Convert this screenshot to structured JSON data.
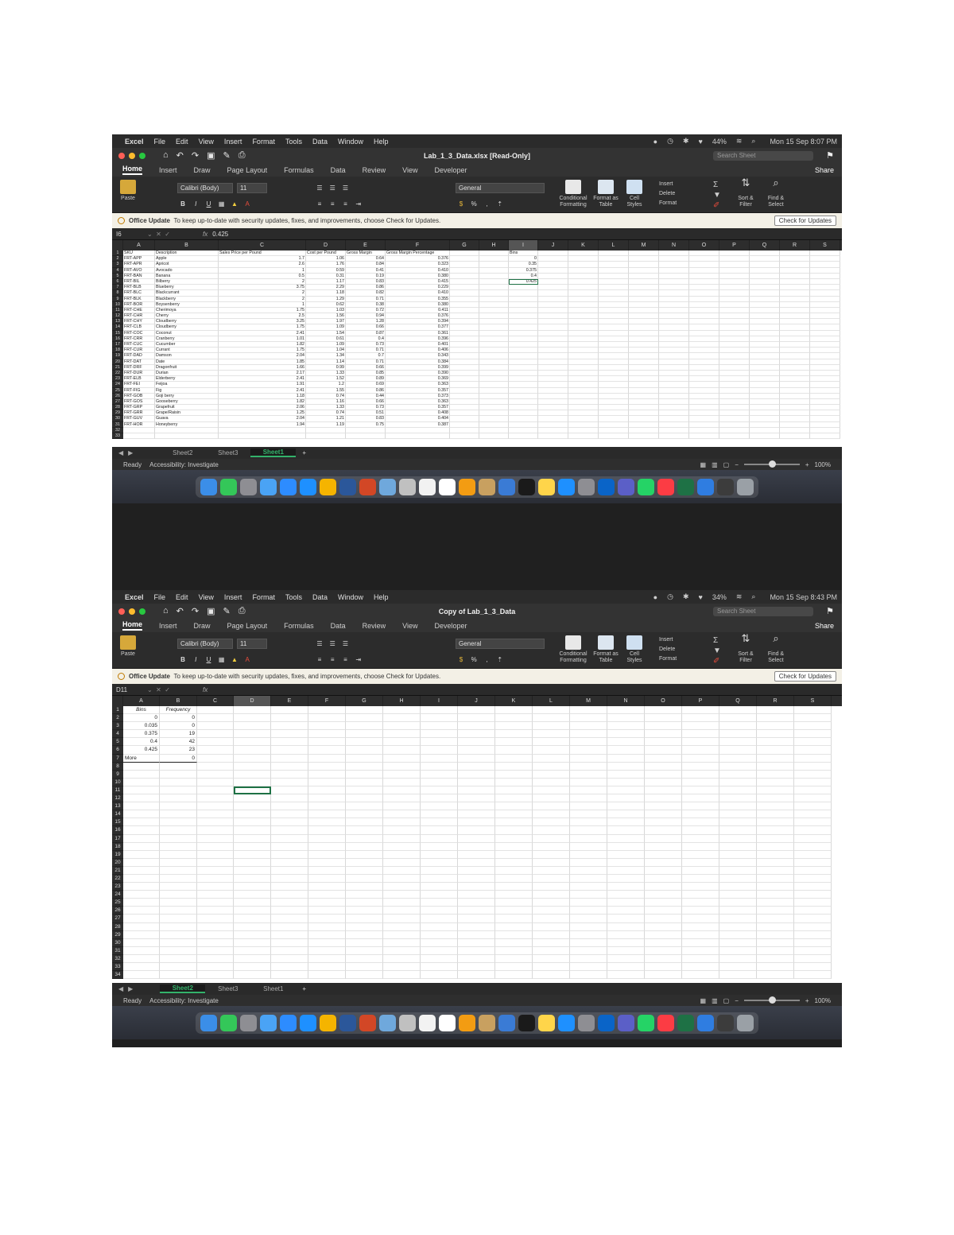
{
  "menubar": {
    "app": "Excel",
    "items": [
      "File",
      "Edit",
      "View",
      "Insert",
      "Format",
      "Tools",
      "Data",
      "Window",
      "Help"
    ],
    "battery": "44%",
    "clock_top": "Mon 15 Sep 8:07 PM",
    "clock_bottom": "Mon 15 Sep 8:43 PM",
    "battery_bottom": "34%"
  },
  "window_top": {
    "title": "Lab_1_3_Data.xlsx  [Read-Only]",
    "search_placeholder": "Search Sheet",
    "share": "Share",
    "tabs": [
      "Home",
      "Insert",
      "Draw",
      "Page Layout",
      "Formulas",
      "Data",
      "Review",
      "View",
      "Developer"
    ],
    "name_box": "I6",
    "formula": "0.425",
    "sheets": [
      "Sheet2",
      "Sheet3",
      "Sheet1"
    ],
    "active_sheet": "Sheet1",
    "status": "Ready",
    "accessibility": "Accessibility: Investigate",
    "zoom": "100%"
  },
  "window_bottom": {
    "title": "Copy of Lab_1_3_Data",
    "search_placeholder": "Search Sheet",
    "share": "Share",
    "tabs": [
      "Home",
      "Insert",
      "Draw",
      "Page Layout",
      "Formulas",
      "Data",
      "Review",
      "View",
      "Developer"
    ],
    "name_box": "D11",
    "formula": "",
    "sheets": [
      "Sheet2",
      "Sheet3",
      "Sheet1"
    ],
    "active_sheet": "Sheet2",
    "status": "Ready",
    "accessibility": "Accessibility: Investigate",
    "zoom": "100%"
  },
  "ribbon": {
    "paste": "Paste",
    "font": "Calibri (Body)",
    "size": "11",
    "number_format": "General",
    "conditional": "Conditional Formatting",
    "format_table": "Format as Table",
    "cell_styles": "Cell Styles",
    "insert": "Insert",
    "delete": "Delete",
    "format": "Format",
    "sort": "Sort & Filter",
    "find": "Find & Select"
  },
  "notice": {
    "label": "Office Update",
    "text": "To keep up-to-date with security updates, fixes, and improvements, choose Check for Updates.",
    "button": "Check for Updates"
  },
  "top_sheet": {
    "columns": [
      "A",
      "B",
      "C",
      "D",
      "E",
      "F",
      "G",
      "H",
      "I",
      "J",
      "K",
      "L",
      "M",
      "N",
      "O",
      "P",
      "Q",
      "R",
      "S"
    ],
    "header": [
      "SKU",
      "Description",
      "Sales Price per Pound",
      "Cost per Pound",
      "Gross Margin",
      "Gross Margin Percentage"
    ],
    "bins_header": "Bins",
    "bins": [
      "0",
      "0.35",
      "0.375",
      "0.4",
      "0.425"
    ],
    "rows": [
      [
        "FRT-APP",
        "Apple",
        "1.7",
        "1.06",
        "0.64",
        "0.376"
      ],
      [
        "FRT-APR",
        "Apricot",
        "2.6",
        "1.76",
        "0.84",
        "0.323"
      ],
      [
        "FRT-AVO",
        "Avocado",
        "1",
        "0.59",
        "0.41",
        "0.410"
      ],
      [
        "FRT-BAN",
        "Banana",
        "0.5",
        "0.31",
        "0.19",
        "0.380"
      ],
      [
        "FRT-BIL",
        "Bilberry",
        "2",
        "1.17",
        "0.83",
        "0.415"
      ],
      [
        "FRT-BLB",
        "Blueberry",
        "3.75",
        "2.29",
        "0.86",
        "0.229"
      ],
      [
        "FRT-BLC",
        "Blackcurrant",
        "2",
        "1.18",
        "0.82",
        "0.410"
      ],
      [
        "FRT-BLK",
        "Blackberry",
        "2",
        "1.29",
        "0.71",
        "0.355"
      ],
      [
        "FRT-BOR",
        "Boysenberry",
        "1",
        "0.62",
        "0.38",
        "0.380"
      ],
      [
        "FRT-CHE",
        "Cherimoya",
        "1.75",
        "1.03",
        "0.72",
        "0.411"
      ],
      [
        "FRT-CHR",
        "Cherry",
        "2.5",
        "1.56",
        "0.94",
        "0.376"
      ],
      [
        "FRT-CHY",
        "Cloudberry",
        "3.25",
        "1.97",
        "1.28",
        "0.394"
      ],
      [
        "FRT-CLB",
        "Cloudberry",
        "1.75",
        "1.09",
        "0.66",
        "0.377"
      ],
      [
        "FRT-COC",
        "Coconut",
        "2.41",
        "1.54",
        "0.87",
        "0.361"
      ],
      [
        "FRT-CRR",
        "Cranberry",
        "1.01",
        "0.61",
        "0.4",
        "0.396"
      ],
      [
        "FRT-CUC",
        "Cucumber",
        "1.82",
        "1.09",
        "0.73",
        "0.401"
      ],
      [
        "FRT-CUR",
        "Currant",
        "1.75",
        "1.04",
        "0.71",
        "0.406"
      ],
      [
        "FRT-DAD",
        "Damson",
        "2.04",
        "1.34",
        "0.7",
        "0.343"
      ],
      [
        "FRT-DAT",
        "Date",
        "1.85",
        "1.14",
        "0.71",
        "0.384"
      ],
      [
        "FRT-DRF",
        "Dragonfruit",
        "1.66",
        "0.99",
        "0.66",
        "0.399"
      ],
      [
        "FRT-DUR",
        "Durian",
        "2.17",
        "1.33",
        "0.85",
        "0.390"
      ],
      [
        "FRT-ELB",
        "Elderberry",
        "2.41",
        "1.52",
        "0.89",
        "0.369"
      ],
      [
        "FRT-FEI",
        "Feijoa",
        "1.91",
        "1.2",
        "0.69",
        "0.363"
      ],
      [
        "FRT-FIG",
        "Fig",
        "2.41",
        "1.55",
        "0.86",
        "0.357"
      ],
      [
        "FRT-GOB",
        "Goji berry",
        "1.18",
        "0.74",
        "0.44",
        "0.373"
      ],
      [
        "FRT-GOS",
        "Gooseberry",
        "1.82",
        "1.16",
        "0.66",
        "0.363"
      ],
      [
        "FRT-GRP",
        "Grapefruit",
        "2.06",
        "1.33",
        "0.73",
        "0.357"
      ],
      [
        "FRT-GRR",
        "Grape/Raisin",
        "1.25",
        "0.74",
        "0.51",
        "0.408"
      ],
      [
        "FRT-GUV",
        "Guava",
        "2.04",
        "1.21",
        "0.83",
        "0.404"
      ],
      [
        "FRT-HOR",
        "Honeyberry",
        "1.94",
        "1.19",
        "0.75",
        "0.387"
      ]
    ]
  },
  "bottom_sheet": {
    "columns": [
      "A",
      "B",
      "C",
      "D",
      "E",
      "F",
      "G",
      "H",
      "I",
      "J",
      "K",
      "L",
      "M",
      "N",
      "O",
      "P",
      "Q",
      "R",
      "S"
    ],
    "header": [
      "Bins",
      "Frequency"
    ],
    "rows": [
      [
        "0",
        "0"
      ],
      [
        "0.035",
        "0"
      ],
      [
        "0.375",
        "19"
      ],
      [
        "0.4",
        "42"
      ],
      [
        "0.425",
        "23"
      ],
      [
        "More",
        "0"
      ]
    ]
  }
}
